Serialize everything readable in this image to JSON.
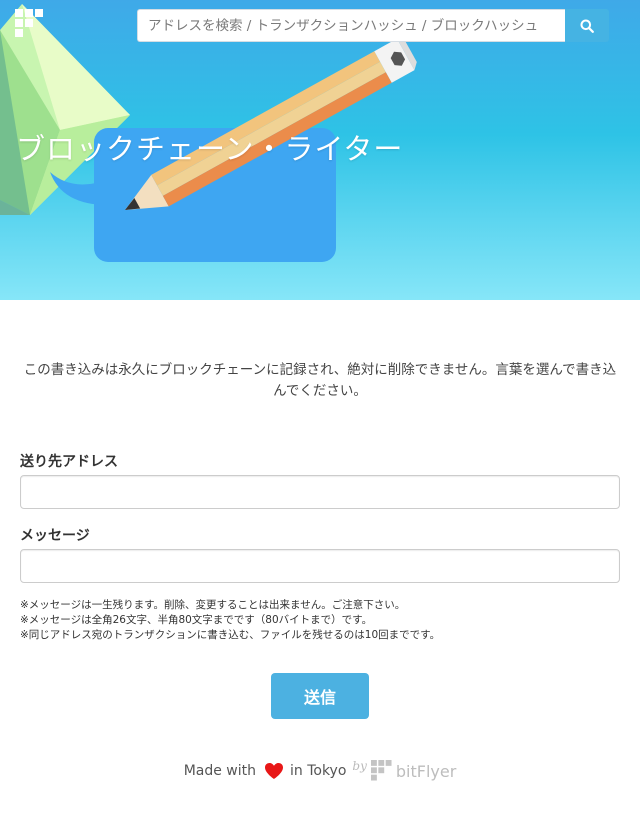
{
  "header": {
    "search": {
      "placeholder": "アドレスを検索 / トランザクションハッシュ / ブロックハッシュ",
      "value": ""
    },
    "title": "ブロックチェーン・ライター",
    "colors": {
      "sky_top": "#3fa9e8",
      "sky_bottom": "#86e6f8",
      "search_button": "#45b3e3"
    },
    "icons": {
      "logo": "bitflyer-logo-icon",
      "search": "search-icon"
    }
  },
  "main": {
    "intro": "この書き込みは永久にブロックチェーンに記録され、絶対に削除できません。言葉を選んで書き込んでください。",
    "address_label": "送り先アドレス",
    "address_value": "",
    "message_label": "メッセージ",
    "message_value": "",
    "notes": [
      "※メッセージは一生残ります。削除、変更することは出来ません。ご注意下さい。",
      "※メッセージは全角26文字、半角80文字までです（80バイトまで）です。",
      "※同じアドレス宛のトランザクションに書き込む、ファイルを残せるのは10回までです。"
    ],
    "submit_label": "送信",
    "submit_color": "#4cb1e1"
  },
  "footer": {
    "made_with": "Made with",
    "in_tokyo": "in Tokyo",
    "by": "by",
    "brand": "bitFlyer",
    "heart_color": "#e81717",
    "icons": {
      "heart": "heart-icon",
      "brand": "bitflyer-logo-icon"
    }
  }
}
